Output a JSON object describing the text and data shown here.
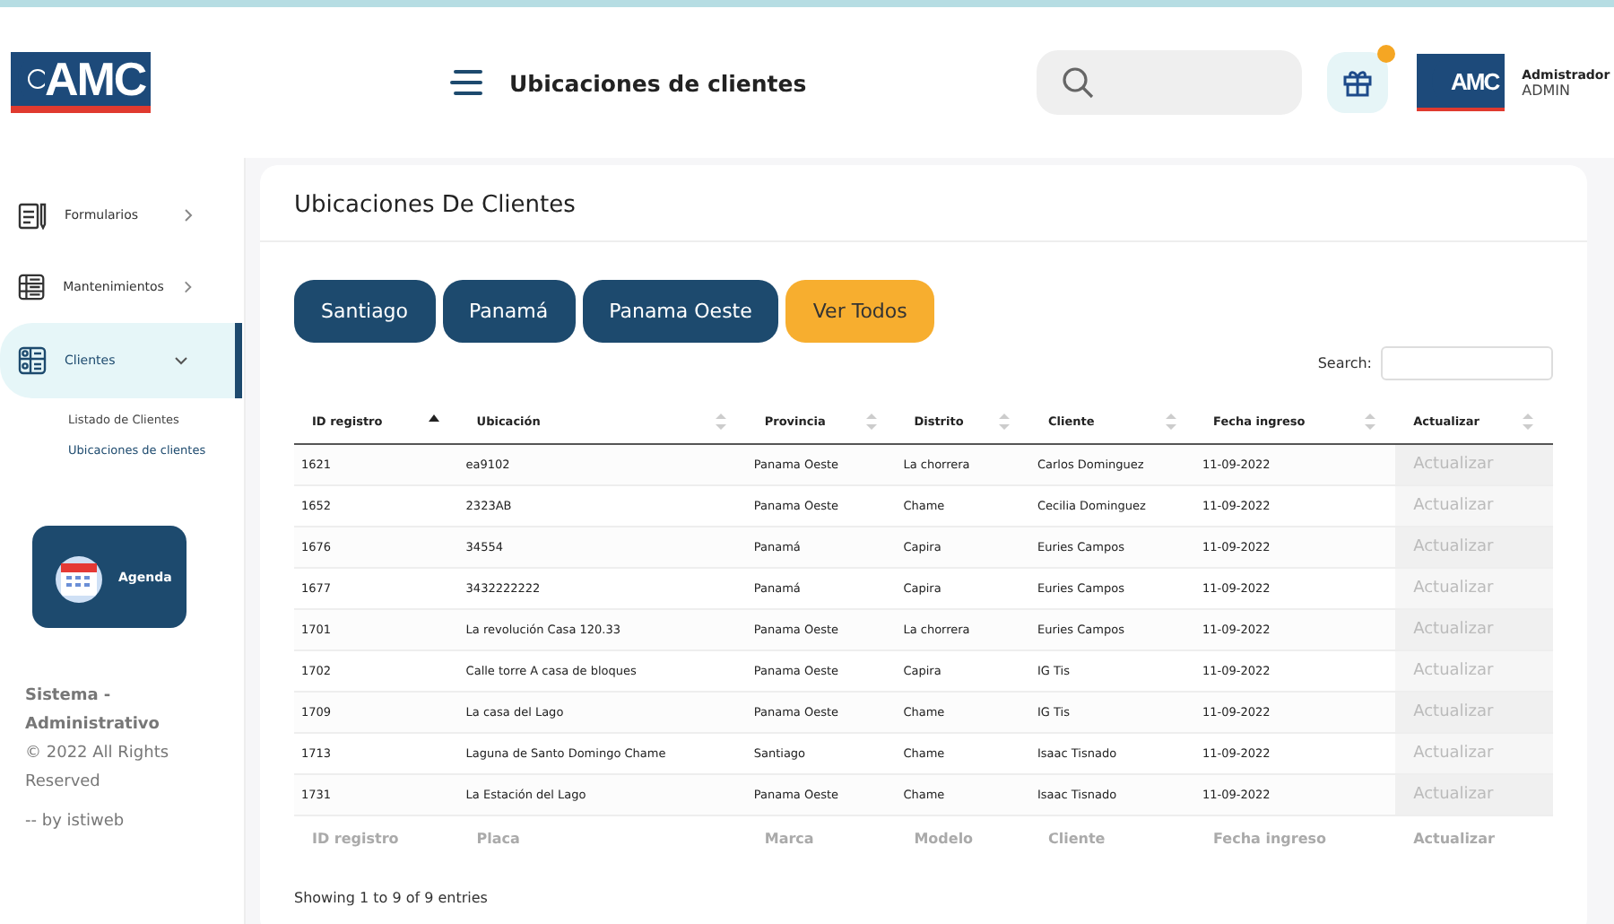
{
  "header": {
    "logo": "AMC",
    "title": "Ubicaciones de clientes",
    "notification": true,
    "user": {
      "logo": "AMC",
      "role": "Admistrador",
      "name": "ADMIN"
    }
  },
  "sidebar": {
    "items": [
      {
        "label": "Formularios",
        "selected": false,
        "expanded": false
      },
      {
        "label": "Mantenimientos",
        "selected": false,
        "expanded": false
      },
      {
        "label": "Clientes",
        "selected": true,
        "expanded": true,
        "children": [
          {
            "label": "Listado de Clientes",
            "selected": false
          },
          {
            "label": "Ubicaciones de clientes",
            "selected": true
          }
        ]
      }
    ],
    "agenda": "Agenda",
    "footer": {
      "title": "Sistema - Administrativo",
      "copyright": "© 2022 All Rights Reserved",
      "credit": "-- by istiweb"
    }
  },
  "card": {
    "title": "Ubicaciones De Clientes",
    "filters": [
      {
        "label": "Santiago",
        "selected": false
      },
      {
        "label": "Panamá",
        "selected": false
      },
      {
        "label": "Panama Oeste",
        "selected": false
      },
      {
        "label": "Ver Todos",
        "selected": true
      }
    ],
    "search_label": "Search:",
    "table": {
      "columns": [
        {
          "label": "ID registro",
          "sorted": true
        },
        {
          "label": "Ubicación",
          "sorted": false
        },
        {
          "label": "Provincia",
          "sorted": false
        },
        {
          "label": "Distrito",
          "sorted": false
        },
        {
          "label": "Cliente",
          "sorted": false
        },
        {
          "label": "Fecha ingreso",
          "sorted": false
        },
        {
          "label": "Actualizar",
          "sorted": false
        }
      ],
      "rows": [
        [
          "1621",
          "ea9102",
          "Panama Oeste",
          "La chorrera",
          "Carlos Dominguez",
          "11-09-2022",
          "Actualizar"
        ],
        [
          "1652",
          "2323AB",
          "Panama Oeste",
          "Chame",
          "Cecilia Dominguez",
          "11-09-2022",
          "Actualizar"
        ],
        [
          "1676",
          "34554",
          "Panamá",
          "Capira",
          "Euries Campos",
          "11-09-2022",
          "Actualizar"
        ],
        [
          "1677",
          "3432222222",
          "Panamá",
          "Capira",
          "Euries Campos",
          "11-09-2022",
          "Actualizar"
        ],
        [
          "1701",
          "La revolución Casa 120.33",
          "Panama Oeste",
          "La chorrera",
          "Euries Campos",
          "11-09-2022",
          "Actualizar"
        ],
        [
          "1702",
          "Calle torre A casa de bloques",
          "Panama Oeste",
          "Capira",
          "IG Tis",
          "11-09-2022",
          "Actualizar"
        ],
        [
          "1709",
          "La casa del Lago",
          "Panama Oeste",
          "Chame",
          "IG Tis",
          "11-09-2022",
          "Actualizar"
        ],
        [
          "1713",
          "Laguna de Santo Domingo Chame",
          "Santiago",
          "Chame",
          "Isaac Tisnado",
          "11-09-2022",
          "Actualizar"
        ],
        [
          "1731",
          "La Estación del Lago",
          "Panama Oeste",
          "Chame",
          "Isaac Tisnado",
          "11-09-2022",
          "Actualizar"
        ]
      ],
      "footer_columns": [
        "ID registro",
        "Placa",
        "Marca",
        "Modelo",
        "Cliente",
        "Fecha ingreso",
        "Actualizar"
      ]
    },
    "info": "Showing 1 to 9 of 9 entries"
  }
}
